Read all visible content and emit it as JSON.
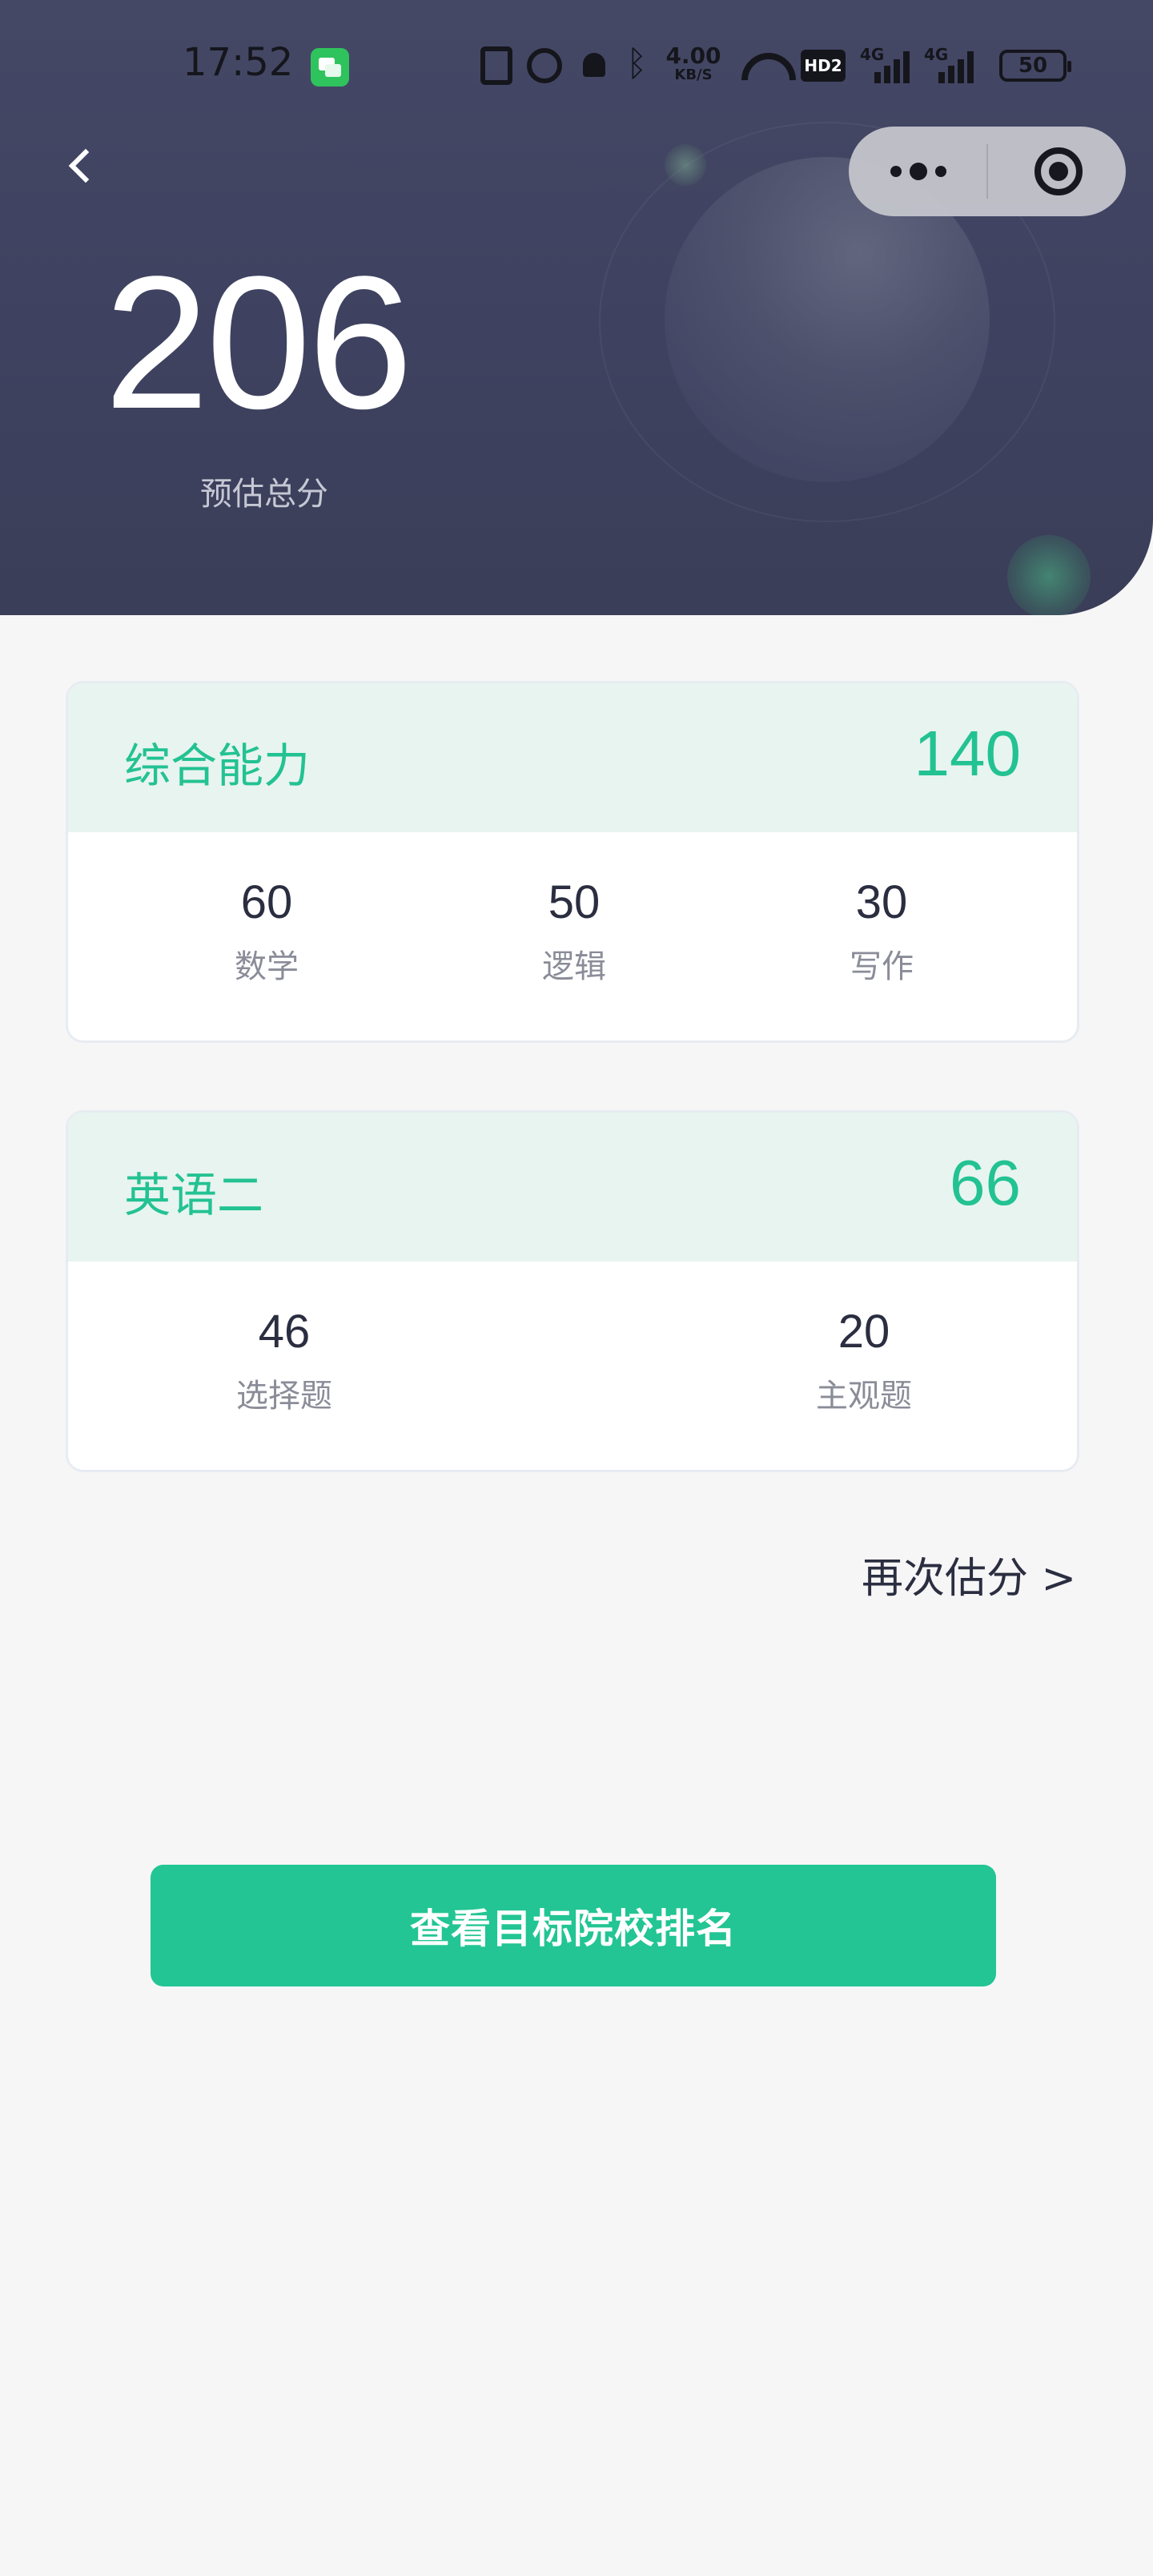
{
  "status_bar": {
    "time": "17:52",
    "speed_value": "4.00",
    "speed_unit": "KB/S",
    "hd_label": "HD2",
    "network1": "4G",
    "network2": "4G",
    "battery": "50"
  },
  "header": {
    "total_score": "206",
    "total_label": "预估总分"
  },
  "cards": [
    {
      "title": "综合能力",
      "score": "140",
      "items": [
        {
          "value": "60",
          "label": "数学"
        },
        {
          "value": "50",
          "label": "逻辑"
        },
        {
          "value": "30",
          "label": "写作"
        }
      ]
    },
    {
      "title": "英语二",
      "score": "66",
      "items": [
        {
          "value": "46",
          "label": "选择题"
        },
        {
          "value": "20",
          "label": "主观题"
        }
      ]
    }
  ],
  "reestimate_label": "再次估分 >",
  "cta_label": "查看目标院校排名",
  "colors": {
    "accent": "#23c292",
    "header_bg": "#3e4260",
    "card_head_bg": "#e8f4f0"
  }
}
